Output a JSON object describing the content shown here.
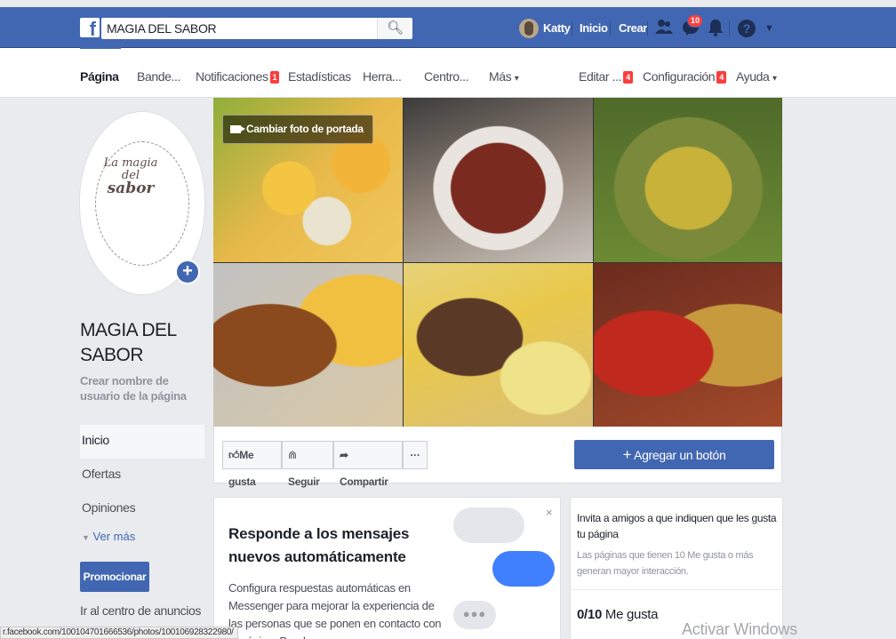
{
  "topbar": {
    "logo": "f",
    "search_value": "MAGIA DEL SABOR",
    "search_icon": "search-icon",
    "user_name": "Katty",
    "home_label": "Inicio",
    "create_label": "Crear",
    "friends_icon": "friends-icon",
    "messenger_icon": "messenger-icon",
    "messenger_badge": "10",
    "notifications_icon": "bell-icon",
    "help_icon": "?",
    "menu_caret": "▼"
  },
  "page_nav": {
    "items": [
      {
        "label": "Página",
        "active": true
      },
      {
        "label": "Bande..."
      },
      {
        "label": "Notificaciones",
        "badge": "1"
      },
      {
        "label": "Estadísticas"
      },
      {
        "label": "Herra..."
      },
      {
        "label": "Centro..."
      },
      {
        "label": "Más",
        "caret": "▾"
      },
      {
        "label": "Editar ...",
        "badge": "4"
      },
      {
        "label": "Configuración",
        "badge": "4"
      },
      {
        "label": "Ayuda",
        "caret": "▾"
      }
    ]
  },
  "profile": {
    "logo_line1": "La magia",
    "logo_line2": "del",
    "logo_line3": "sabor",
    "add_icon": "+",
    "page_name": "MAGIA DEL SABOR",
    "username_link": "Crear nombre de usuario de la página"
  },
  "left_nav": {
    "items": [
      "Inicio",
      "Ofertas",
      "Opiniones"
    ],
    "more": "Ver más",
    "promote": "Promocionar",
    "ads_center": "Ir al centro de anuncios"
  },
  "cover": {
    "change_button": "Cambiar foto de portada"
  },
  "actions": {
    "like": "Me gusta",
    "follow": "Seguir",
    "share": "Compartir",
    "more": "···",
    "add_button": "Agregar un botón",
    "add_icon": "+"
  },
  "messenger_card": {
    "close": "×",
    "title": "Responde a los mensajes nuevos automáticamente",
    "body": "Configura respuestas automáticas en Messenger para mejorar la experiencia de las personas que se ponen en contacto con tu página. Puedes",
    "dots": "●●●"
  },
  "invite_card": {
    "title": "Invita a amigos a que indiquen que les gusta tu página",
    "subtitle": "Las páginas que tienen 10 Me gusta o más generan mayor interacción.",
    "count": "0/10",
    "count_label": "Me gusta"
  },
  "watermark": "Activar Windows",
  "status_url": "r.facebook.com/100104701666536/photos/100106928322980/"
}
